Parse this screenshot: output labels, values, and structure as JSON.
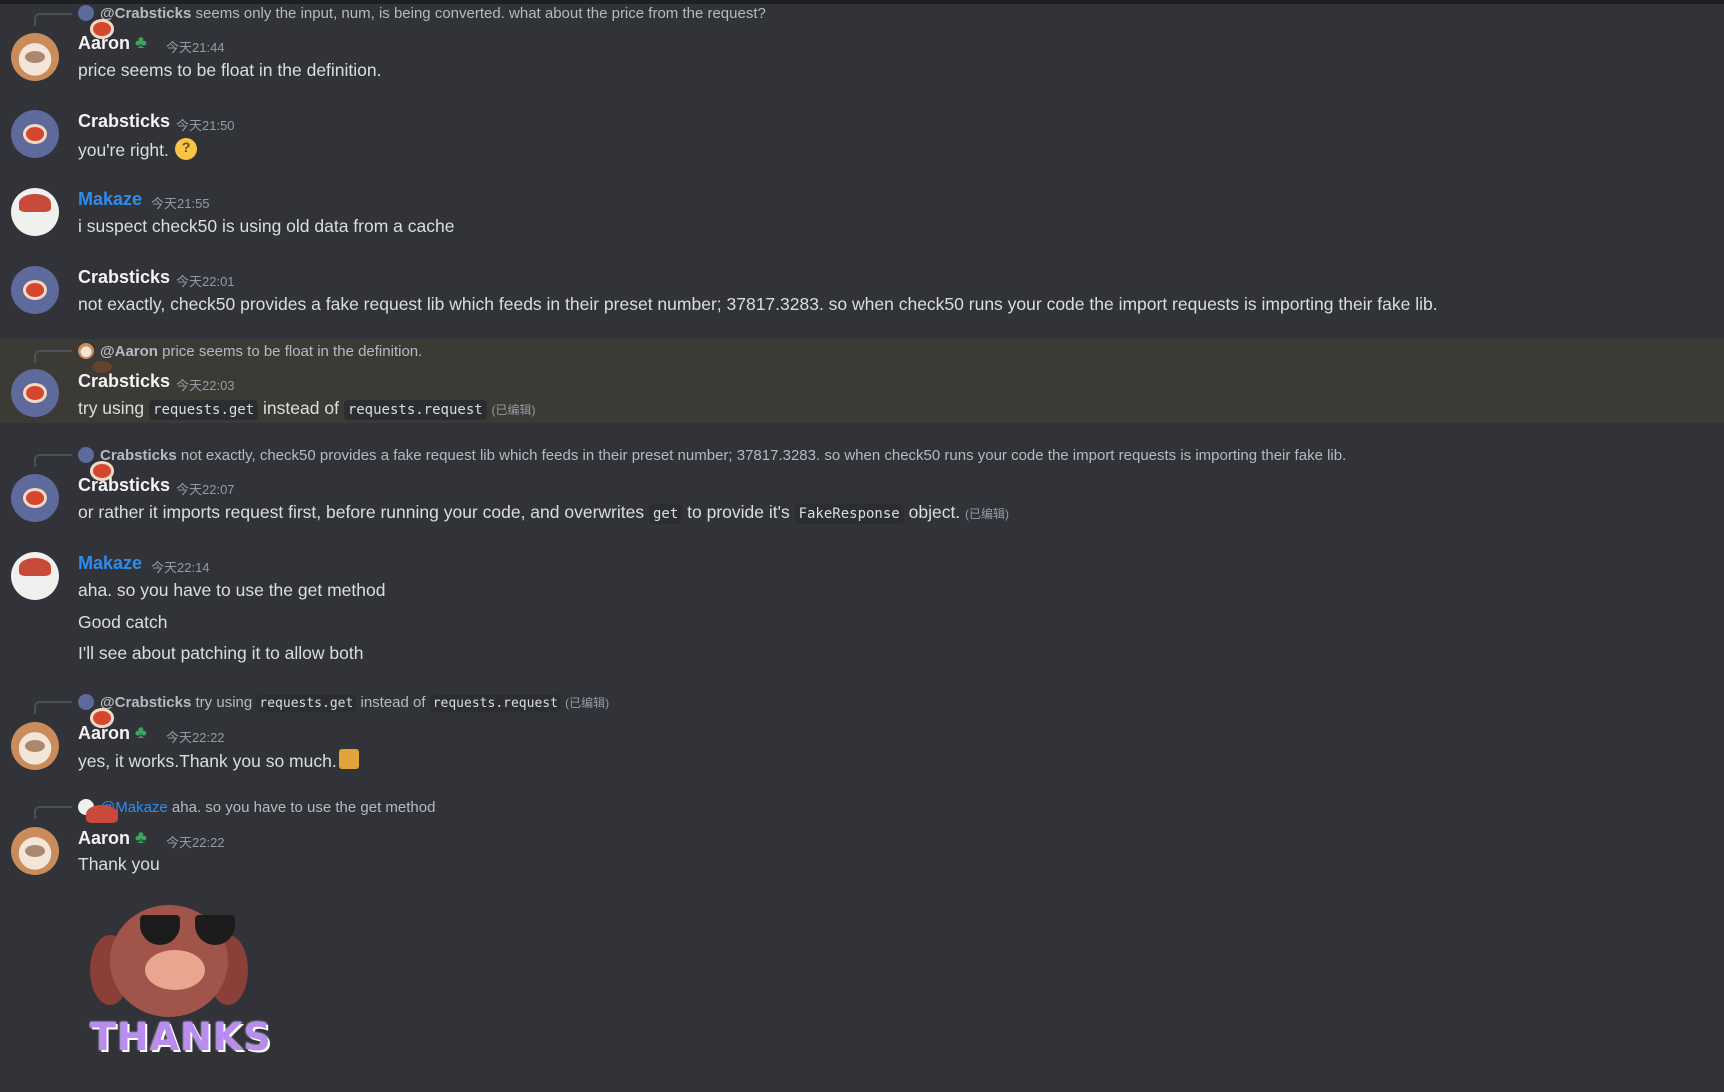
{
  "messages": [
    {
      "reply": {
        "name": "@Crabsticks",
        "text": "seems only the input, num, is being converted. what about the price from the request?"
      },
      "author": "Aaron",
      "time": "今天21:44",
      "lines": [
        "price seems to be float in the definition."
      ]
    },
    {
      "author": "Crabsticks",
      "time": "今天21:50",
      "lines": [
        "you're right."
      ]
    },
    {
      "author": "Makaze",
      "time": "今天21:55",
      "lines": [
        "i suspect check50 is using old data from a cache"
      ]
    },
    {
      "author": "Crabsticks",
      "time": "今天22:01",
      "lines": [
        "not exactly, check50 provides a fake request lib which feeds in their preset number; 37817.3283. so when check50 runs your code the import requests is importing their fake lib."
      ]
    },
    {
      "reply": {
        "name": "@Aaron",
        "text": "price seems to be float in the definition."
      },
      "author": "Crabsticks",
      "time": "今天22:03",
      "parts": {
        "a": "try using",
        "code1": "requests.get",
        "b": "instead of",
        "code2": "requests.request",
        "edited": "(已编辑)"
      }
    },
    {
      "reply": {
        "name": "Crabsticks",
        "text": "not exactly, check50 provides a fake request lib which feeds in their preset number; 37817.3283. so when check50 runs your code the import requests is importing their fake lib."
      },
      "author": "Crabsticks",
      "time": "今天22:07",
      "parts": {
        "a": "or rather it imports request first, before running your code, and overwrites",
        "code1": "get",
        "b": "to provide it's",
        "code2": "FakeResponse",
        "c": "object.",
        "edited": "(已编辑)"
      }
    },
    {
      "author": "Makaze",
      "time": "今天22:14",
      "lines": [
        "aha. so you have to use the get method",
        "Good catch",
        "I'll see about patching it to allow both"
      ]
    },
    {
      "reply": {
        "name": "@Crabsticks",
        "a": "try using",
        "code1": "requests.get",
        "b": "instead of",
        "code2": "requests.request",
        "edited": "(已编辑)"
      },
      "author": "Aaron",
      "time": "今天22:22",
      "lines": [
        "yes, it works.Thank you so much."
      ]
    },
    {
      "reply": {
        "name": "@Makaze",
        "text": "aha. so you have to use the get method"
      },
      "author": "Aaron",
      "time": "今天22:22",
      "lines": [
        "Thank you"
      ],
      "sticker": "THANKS"
    }
  ],
  "icons": {
    "badge": "clover-badge-icon",
    "thinking": "thinking-face-emoji",
    "thanks": "thanks-sticker-emoji"
  },
  "colors": {
    "background": "#313338",
    "highlight": "#3c3a35",
    "makaze_name": "#2d8cf0",
    "badge": "#3ba55d"
  }
}
